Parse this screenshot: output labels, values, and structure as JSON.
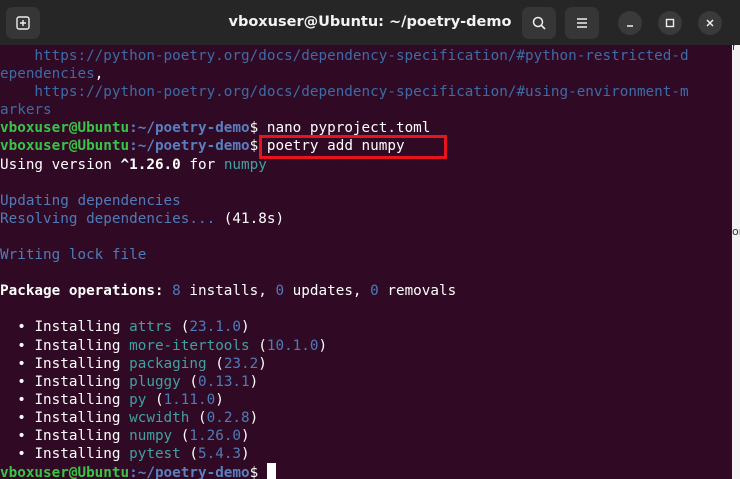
{
  "window": {
    "title": "vboxuser@Ubuntu: ~/poetry-demo",
    "new_tab_icon": "new-tab-icon",
    "search_icon": "search-icon",
    "menu_icon": "hamburger-menu-icon"
  },
  "terminal": {
    "prompt_user": "vboxuser@Ubuntu",
    "prompt_path": ":~/poetry-demo",
    "lines": {
      "url1": "    https://python-poetry.org/docs/dependency-specification/#python-restricted-d",
      "url1b": "ependencies",
      "url1b_suffix": ",",
      "url2": "    https://python-poetry.org/docs/dependency-specification/#using-environment-m",
      "url2b": "arkers",
      "cmd1": "$ nano pyproject.toml",
      "cmd2": "$ poetry add numpy",
      "using_prefix": "Using version ",
      "using_version": "^1.26.0",
      "using_for": " for ",
      "using_pkg": "numpy",
      "updating": "Updating dependencies",
      "resolving": "Resolving dependencies...",
      "resolving_time": " (41.8s)",
      "writing": "Writing lock file",
      "pkg_ops_label": "Package operations:",
      "pkg_installs_n": "8",
      "pkg_installs": " installs, ",
      "pkg_updates_n": "0",
      "pkg_updates": " updates, ",
      "pkg_removals_n": "0",
      "pkg_removals": " removals",
      "final_prompt_symbol": "$ "
    },
    "installs": [
      {
        "bullet": "  • ",
        "action": "Installing ",
        "pkg": "attrs",
        "version": "23.1.0"
      },
      {
        "bullet": "  • ",
        "action": "Installing ",
        "pkg": "more-itertools",
        "version": "10.1.0"
      },
      {
        "bullet": "  • ",
        "action": "Installing ",
        "pkg": "packaging",
        "version": "23.2"
      },
      {
        "bullet": "  • ",
        "action": "Installing ",
        "pkg": "pluggy",
        "version": "0.13.1"
      },
      {
        "bullet": "  • ",
        "action": "Installing ",
        "pkg": "py",
        "version": "1.11.0"
      },
      {
        "bullet": "  • ",
        "action": "Installing ",
        "pkg": "wcwidth",
        "version": "0.2.8"
      },
      {
        "bullet": "  • ",
        "action": "Installing ",
        "pkg": "numpy",
        "version": "1.26.0"
      },
      {
        "bullet": "  • ",
        "action": "Installing ",
        "pkg": "pytest",
        "version": "5.4.3"
      }
    ]
  },
  "background_fragments": [
    "r",
    "or"
  ],
  "colors": {
    "terminal_bg": "#300a24",
    "prompt_green": "#39c447",
    "path_blue": "#5a7fc0",
    "highlight_red": "#e8141c"
  }
}
